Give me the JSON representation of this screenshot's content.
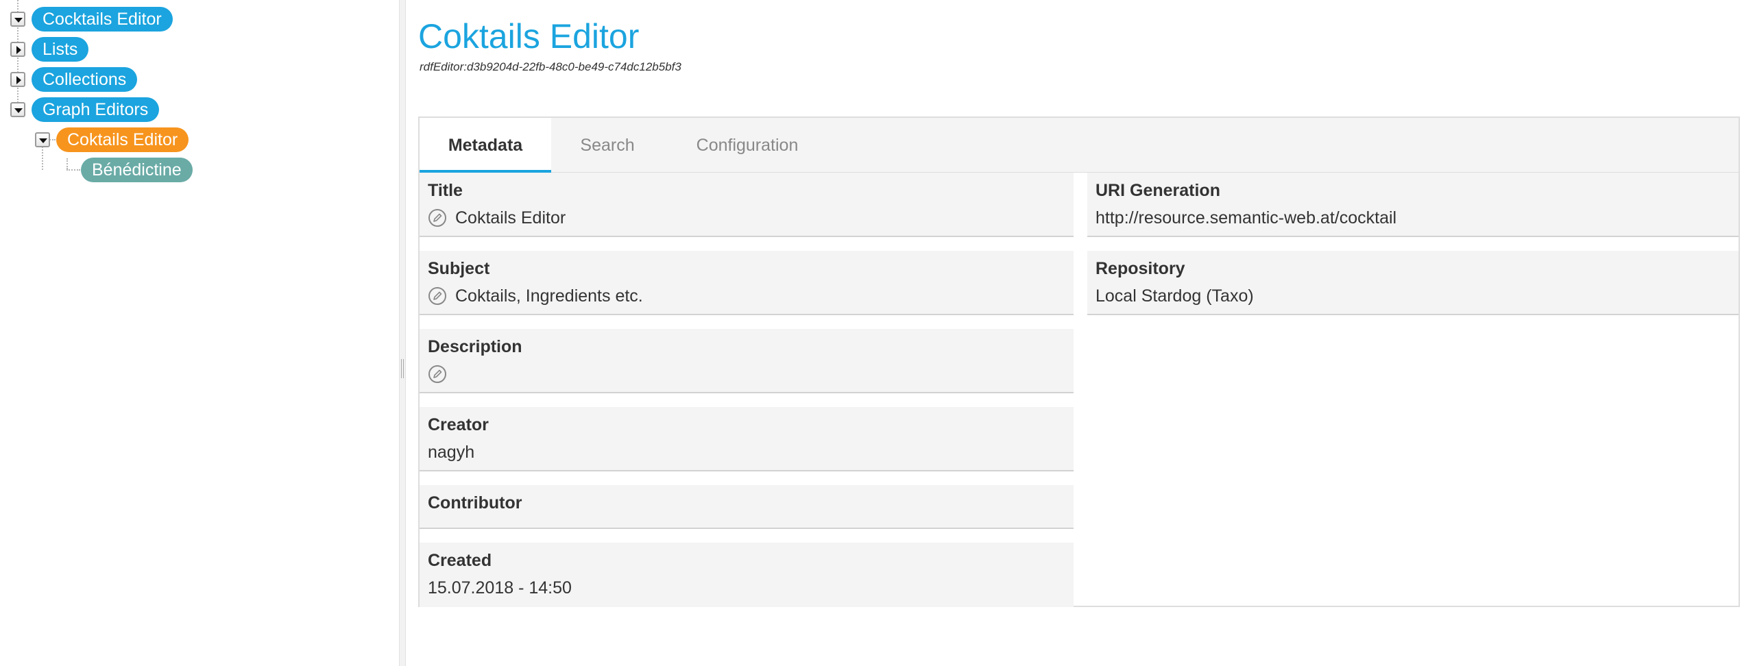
{
  "tree": {
    "nodes": [
      {
        "label": "Cocktails Editor",
        "state": "expanded",
        "color": "#1ba4df"
      },
      {
        "label": "Lists",
        "state": "collapsed",
        "color": "#1ba4df"
      },
      {
        "label": "Collections",
        "state": "collapsed",
        "color": "#1ba4df"
      },
      {
        "label": "Graph Editors",
        "state": "expanded",
        "color": "#1ba4df"
      },
      {
        "label": "Coktails Editor",
        "state": "expanded-selected",
        "color": "#f7941d"
      },
      {
        "label": "Bénédictine",
        "state": "leaf",
        "color": "#6aaba6"
      }
    ]
  },
  "main": {
    "title": "Coktails Editor",
    "identifier": "rdfEditor:d3b9204d-22fb-48c0-be49-c74dc12b5bf3",
    "tabs": [
      {
        "label": "Metadata",
        "active": true
      },
      {
        "label": "Search",
        "active": false
      },
      {
        "label": "Configuration",
        "active": false
      }
    ],
    "left_fields": [
      {
        "label": "Title",
        "value": "Coktails Editor",
        "editable": true
      },
      {
        "label": "Subject",
        "value": "Coktails, Ingredients etc.",
        "editable": true
      },
      {
        "label": "Description",
        "value": "",
        "editable": true
      },
      {
        "label": "Creator",
        "value": "nagyh",
        "editable": false
      },
      {
        "label": "Contributor",
        "value": "",
        "editable": false
      },
      {
        "label": "Created",
        "value": "15.07.2018 - 14:50",
        "editable": false
      }
    ],
    "right_fields": [
      {
        "label": "URI Generation",
        "value": "http://resource.semantic-web.at/cocktail"
      },
      {
        "label": "Repository",
        "value": "Local Stardog (Taxo)"
      }
    ]
  },
  "icons": {
    "expand_toggle": "triangle-down-icon",
    "collapse_toggle": "triangle-right-icon",
    "edit": "pencil-edit-icon"
  },
  "colors": {
    "accent": "#1ba4df",
    "selected_node": "#f7941d",
    "concept_node": "#6aaba6"
  }
}
